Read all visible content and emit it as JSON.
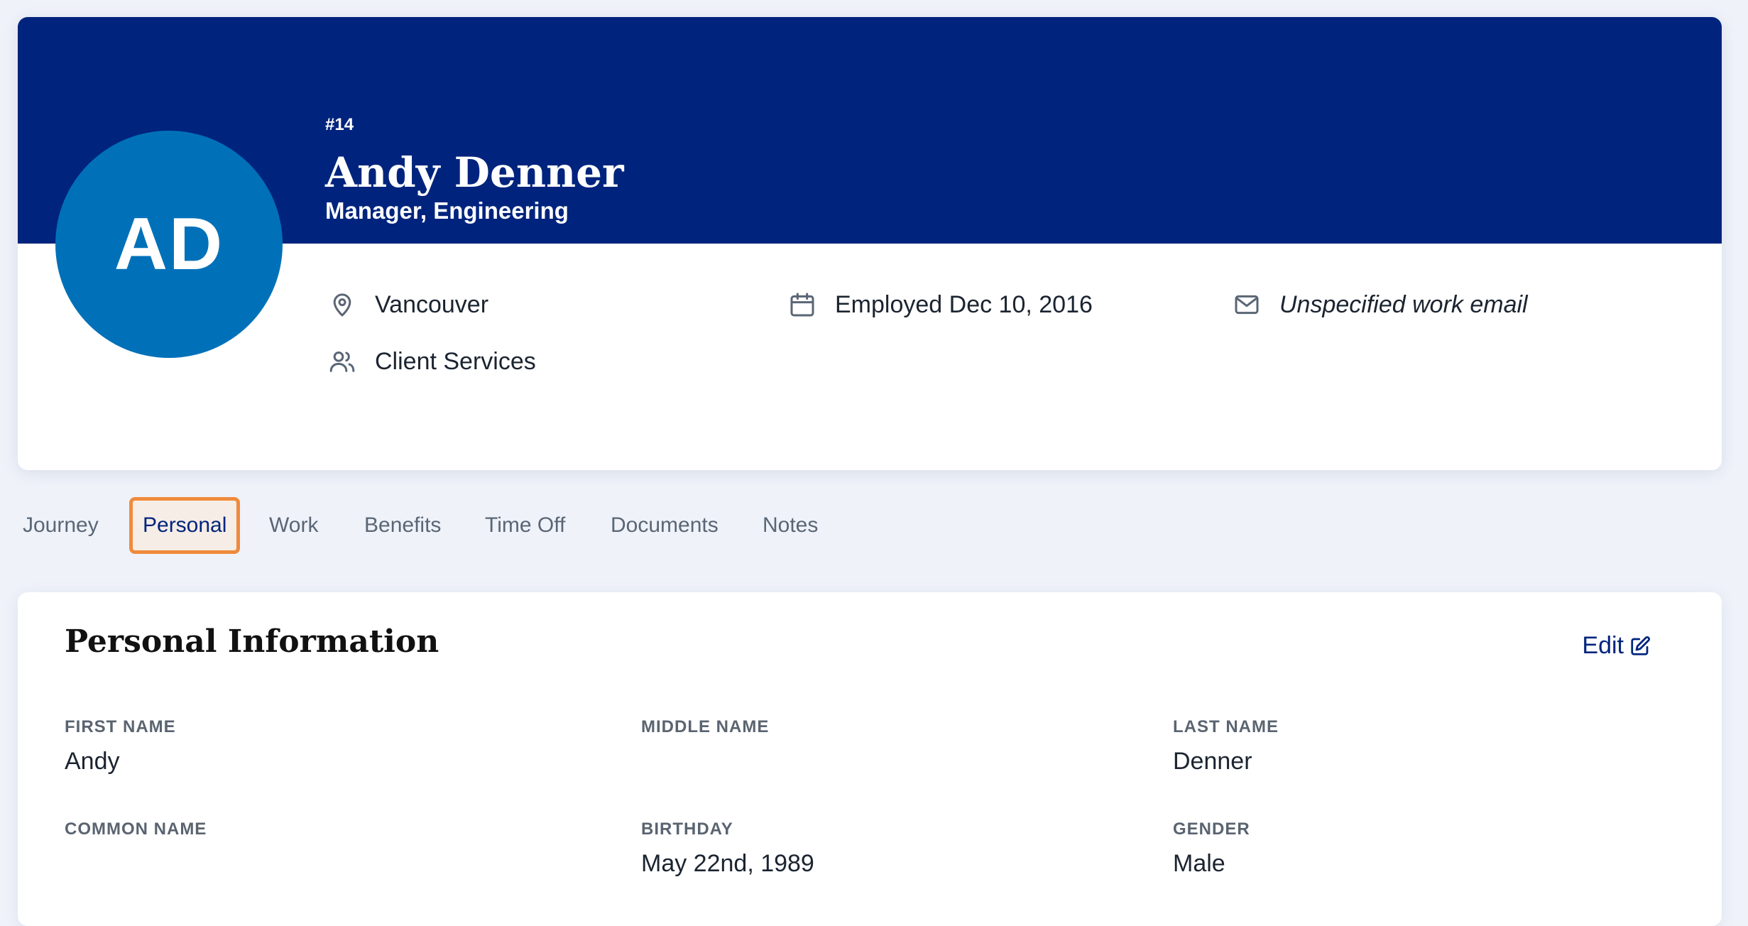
{
  "profile": {
    "initials": "AD",
    "number": "#14",
    "name": "Andy Denner",
    "title": "Manager, Engineering",
    "location": "Vancouver",
    "department": "Client Services",
    "employed": "Employed Dec 10, 2016",
    "email": "Unspecified work email",
    "icons": {
      "location": "map-pin-icon",
      "department": "users-icon",
      "employed": "calendar-icon",
      "email": "mail-icon"
    }
  },
  "tabs": [
    {
      "label": "Journey",
      "active": false
    },
    {
      "label": "Personal",
      "active": true
    },
    {
      "label": "Work",
      "active": false
    },
    {
      "label": "Benefits",
      "active": false
    },
    {
      "label": "Time Off",
      "active": false
    },
    {
      "label": "Documents",
      "active": false
    },
    {
      "label": "Notes",
      "active": false
    }
  ],
  "personal": {
    "heading": "Personal Information",
    "edit_label": "Edit",
    "fields": {
      "first_name": {
        "label": "FIRST NAME",
        "value": "Andy"
      },
      "middle_name": {
        "label": "MIDDLE NAME",
        "value": ""
      },
      "last_name": {
        "label": "LAST NAME",
        "value": "Denner"
      },
      "common_name": {
        "label": "COMMON NAME",
        "value": ""
      },
      "birthday": {
        "label": "BIRTHDAY",
        "value": "May 22nd, 1989"
      },
      "gender": {
        "label": "GENDER",
        "value": "Male"
      }
    }
  },
  "colors": {
    "banner": "#00247d",
    "avatar": "#0071b9",
    "active_tab_border": "#f08a3c",
    "link": "#00247d"
  }
}
